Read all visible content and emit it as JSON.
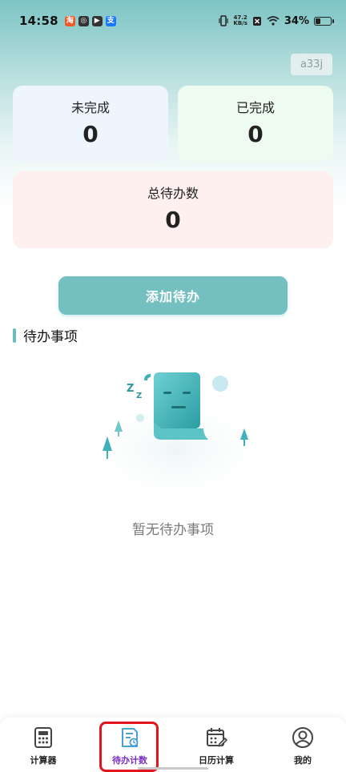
{
  "status_bar": {
    "time": "14:58",
    "net_speed_value": "47.2",
    "net_speed_unit": "KB/s",
    "battery": "34%"
  },
  "user_badge": "a33j",
  "stats": {
    "incomplete_label": "未完成",
    "incomplete_value": "0",
    "complete_label": "已完成",
    "complete_value": "0",
    "total_label": "总待办数",
    "total_value": "0"
  },
  "add_button": "添加待办",
  "section_title": "待办事项",
  "empty_text": "暂无待办事项",
  "nav": {
    "calculator": "计算器",
    "todo_count": "待办计数",
    "date_calc": "日历计算",
    "me": "我的"
  },
  "colors": {
    "accent": "#74bfc0",
    "active_nav": "#7b2fbf",
    "highlight": "#e4141c"
  }
}
